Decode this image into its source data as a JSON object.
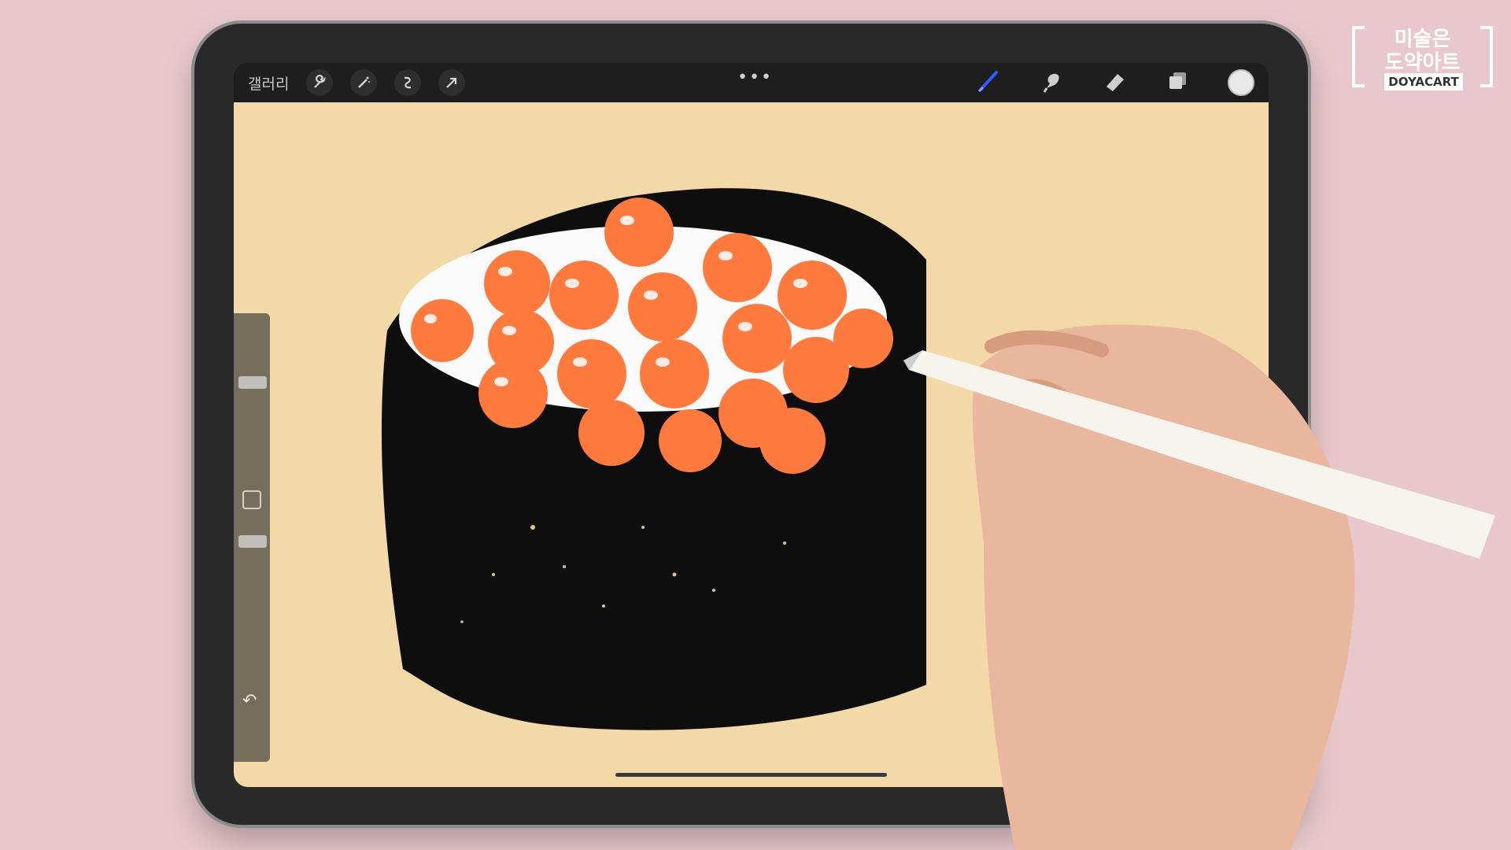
{
  "toolbar": {
    "gallery_label": "갤러리",
    "left_icons": [
      "wrench-icon",
      "magic-wand-icon",
      "selection-icon",
      "transform-arrow-icon"
    ],
    "more_icon": "•••",
    "right_icons": [
      "brush-icon",
      "smudge-icon",
      "eraser-icon",
      "layers-icon"
    ],
    "active_tool": "brush-icon",
    "active_color": "#e9e9e9"
  },
  "sidebar": {
    "size_slider": 0.55,
    "opacity_slider": 0.3,
    "undo_icon": "↶"
  },
  "logo": {
    "line1": "미술은",
    "line2": "도약아트",
    "line3": "DOYACART"
  },
  "colors": {
    "canvas": "#f4d9a8",
    "roe": "#ff7a3c",
    "seaweed": "#0e0e0e",
    "rice": "#fafafa",
    "brush_accent": "#2c5cff"
  }
}
